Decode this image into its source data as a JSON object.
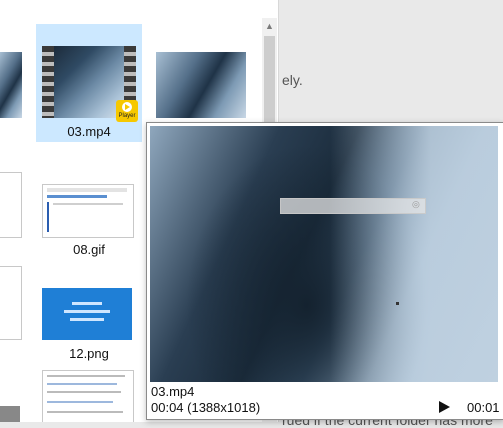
{
  "explorer": {
    "items": [
      {
        "name": "03.mp4",
        "badge": "Player"
      },
      {
        "name": "08.gif"
      },
      {
        "name": "12.png"
      }
    ]
  },
  "preview": {
    "filename": "03.mp4",
    "position_and_size": "00:04 (1388x1018)",
    "duration": "00:01"
  },
  "background_text": {
    "fragment_top": "ely.",
    "fragment_bottom": "rued if the current folder has more"
  },
  "colors": {
    "selection": "#cce8ff",
    "badge": "#f6c800"
  }
}
